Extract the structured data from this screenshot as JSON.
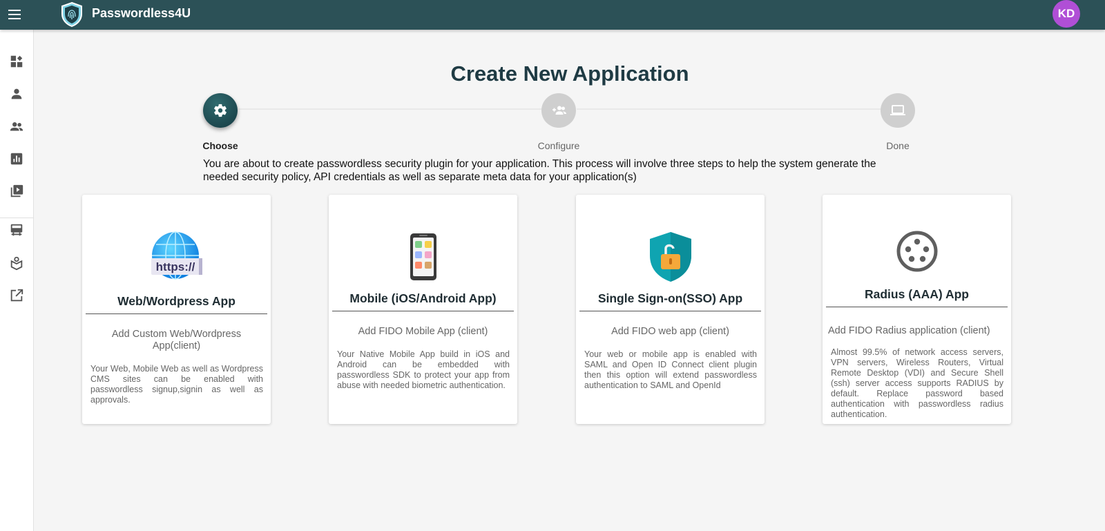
{
  "header": {
    "brand": "Passwordless4U",
    "avatar_initials": "KD",
    "bar_color": "#2c5157",
    "avatar_color": "#b04fd6"
  },
  "sidebar": {
    "items": [
      {
        "icon": "dashboard-icon"
      },
      {
        "icon": "person-icon"
      },
      {
        "icon": "group-icon"
      },
      {
        "icon": "analytics-icon"
      },
      {
        "icon": "video-library-icon"
      },
      {
        "icon": "card-display-icon"
      },
      {
        "icon": "package-icon"
      },
      {
        "icon": "open-in-new-icon"
      }
    ]
  },
  "page": {
    "title": "Create New Application",
    "intro": "You are about to create passwordless security plugin for your application. This process will involve three steps to help the system generate the needed security policy, API credentials as well as separate meta data for your application(s)"
  },
  "stepper": {
    "steps": [
      {
        "label": "Choose",
        "icon": "gear-icon",
        "active": true
      },
      {
        "label": "Configure",
        "icon": "group-add-icon",
        "active": false
      },
      {
        "label": "Done",
        "icon": "laptop-icon",
        "active": false
      }
    ]
  },
  "cards": [
    {
      "icon": "globe-https-icon",
      "title": "Web/Wordpress App",
      "subtitle": "Add Custom Web/Wordpress App(client)",
      "description": "Your Web, Mobile Web as well as Wordpress CMS sites can be enabled with passwordless signup,signin as well as approvals."
    },
    {
      "icon": "smartphone-icon",
      "title": "Mobile (iOS/Android App)",
      "subtitle": "Add FIDO Mobile App (client)",
      "description": "Your Native Mobile App build in iOS and Android can be embedded with passwordless SDK to protect your app from abuse with needed biometric authentication."
    },
    {
      "icon": "shield-unlock-icon",
      "title": "Single Sign-on(SSO) App",
      "subtitle": "Add FIDO web app (client)",
      "description": "Your web or mobile app is enabled with SAML and Open ID Connect client plugin then this option will extend passwordless authentication to SAML and OpenId"
    },
    {
      "icon": "radius-connector-icon",
      "title": "Radius (AAA) App",
      "subtitle": "Add FIDO Radius application (client)",
      "description": "Almost 99.5% of network access servers, VPN servers, Wireless Routers, Virtual Remote Desktop (VDI) and Secure Shell (ssh) server access supports RADIUS by default. Replace password based authentication with passwordless radius authentication."
    }
  ]
}
